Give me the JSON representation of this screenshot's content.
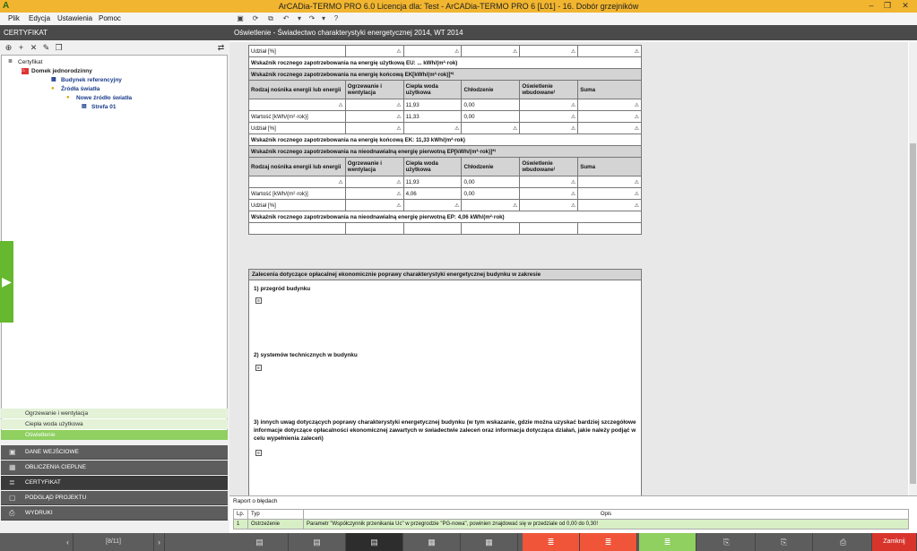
{
  "title": "ArCADia-TERMO PRO 6.0 Licencja dla: Test - ArCADia-TERMO PRO 6 [L01] - 16. Dobór grzejników",
  "window_buttons": [
    "–",
    "❐",
    "✕"
  ],
  "menu": [
    "Plik",
    "Edycja",
    "Ustawienia",
    "Pomoc"
  ],
  "left": {
    "header": "CERTYFIKAT",
    "tree": [
      "Certyfikat",
      "Domek jednorodzinny",
      "Budynek referencyjny",
      "Źródła światła",
      "Nowe źródło światła",
      "Strefa 01"
    ],
    "subs": [
      "Ogrzewanie i wentylacja",
      "Ciepła woda użytkowa",
      "Oświetlenie"
    ],
    "nav": [
      "DANE WEJŚCIOWE",
      "OBLICZENIA CIEPLNE",
      "CERTYFIKAT",
      "PODGLĄD PROJEKTU",
      "WYDRUKI"
    ]
  },
  "main": {
    "header": "Oświetlenie - Świadectwo charakterystyki energetycznej 2014, WT 2014",
    "t0": {
      "udzial": "Udział [%]",
      "eu": "Wskaźnik rocznego zapotrzebowania na energię użytkową EU: ... kWh/(m²·rok)"
    },
    "t1": {
      "title": "Wskaźnik rocznego zapotrzebowania na energię końcową EK[kWh/(m²·rok)]*⁾",
      "cols": [
        "Rodzaj nośnika energii lub energii",
        "Ogrzewanie i wentylacja",
        "Ciepła woda użytkowa",
        "Chłodzenie",
        "Oświetlenie wbudowane⁾",
        "Suma"
      ],
      "r1": [
        "",
        "",
        "11,93",
        "0,00",
        "",
        ""
      ],
      "r2": [
        "Wartość [kWh/(m²·rok)]",
        "",
        "11,33",
        "0,00",
        "",
        ""
      ],
      "r3": [
        "Udział [%]",
        "",
        "",
        "",
        "",
        ""
      ],
      "summary": "Wskaźnik rocznego zapotrzebowania na energię końcową EK: 11,33 kWh/(m²·rok)"
    },
    "t2": {
      "title": "Wskaźnik rocznego zapotrzebowania na nieodnawialną energię pierwotną EP[kWh/(m²·rok)]*⁾",
      "cols": [
        "Rodzaj nośnika energii lub energii",
        "Ogrzewanie i wentylacja",
        "Ciepła woda użytkowa",
        "Chłodzenie",
        "Oświetlenie wbudowane⁾",
        "Suma"
      ],
      "r1": [
        "",
        "",
        "11,93",
        "0,00",
        "",
        ""
      ],
      "r2": [
        "Wartość [kWh/(m²·rok)]",
        "",
        "4,06",
        "0,00",
        "",
        ""
      ],
      "r3": [
        "Udział [%]",
        "",
        "",
        "",
        "",
        ""
      ],
      "summary": "Wskaźnik rocznego zapotrzebowania na nieodnawialną energię pierwotną EP: 4,06 kWh/(m²·rok)"
    },
    "rec": {
      "header": "Zalecenia dotyczące opłacalnej ekonomicznie poprawy charakterystyki energetycznej budynku w zakresie",
      "s1": "1) przegród budynku",
      "s2": "2) systemów technicznych w budynku",
      "s3": "3) innych uwag dotyczących poprawy charakterystyki energetycznej budynku (w tym wskazanie, gdzie można uzyskać bardziej szczegółowe informacje dotyczące opłacalności ekonomicznej zawartych w świadectwie zaleceń oraz informacja dotycząca działań, jakie należy podjąć w celu wypełnienia zaleceń)"
    }
  },
  "report": {
    "label": "Raport o błędach",
    "cols": [
      "Lp.",
      "Typ",
      "Opis"
    ],
    "row": [
      "1",
      "Ostrzeżenie",
      "Parametr \"Współczynnik przenikania Uc\" w przegrodzie \"PG-nowa\", powinien znajdować się w przedziale od 0,00 do 0,30!"
    ]
  },
  "pager": "[8/11]",
  "close": "Zamknij",
  "colors": {
    "accent": "#66b82e",
    "title": "#f1b52f",
    "close": "#d9342b",
    "orange": "#f0553a"
  }
}
